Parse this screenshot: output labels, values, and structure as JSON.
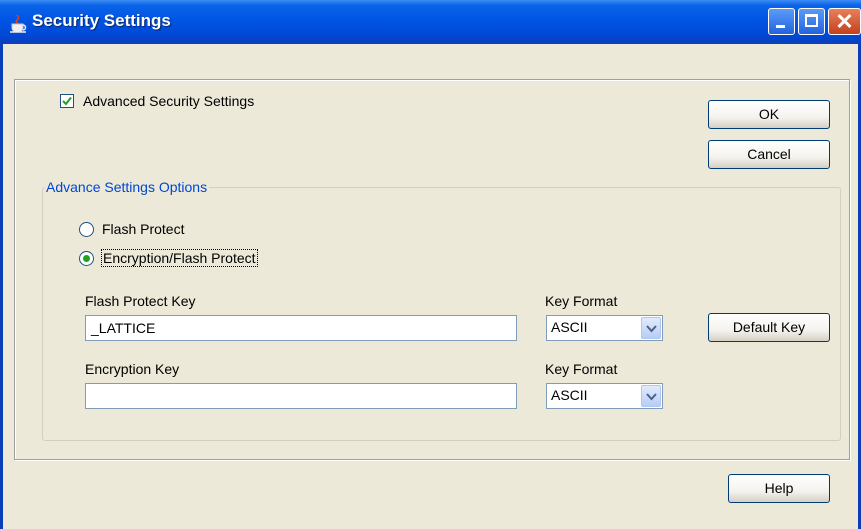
{
  "window": {
    "title": "Security Settings",
    "controls": [
      "minimize-icon",
      "maximize-icon",
      "close-icon"
    ]
  },
  "advanced_security": {
    "label": "Advanced Security Settings",
    "checked": true
  },
  "buttons": {
    "ok": "OK",
    "cancel": "Cancel",
    "default_key": "Default Key",
    "help": "Help"
  },
  "options_group": {
    "title": "Advance Settings Options",
    "radios": [
      {
        "label": "Flash Protect",
        "selected": false
      },
      {
        "label": "Encryption/Flash Protect",
        "selected": true
      }
    ]
  },
  "flash_protect_key": {
    "label": "Flash Protect Key",
    "value": "_LATTICE",
    "format_label": "Key Format",
    "format_value": "ASCII"
  },
  "encryption_key": {
    "label": "Encryption Key",
    "value": "",
    "format_label": "Key Format",
    "format_value": "ASCII"
  },
  "colors": {
    "titlebar": "#0055e5",
    "window_bg": "#ece9d8",
    "group_title": "#0046d5",
    "radio_dot": "#21a121"
  }
}
